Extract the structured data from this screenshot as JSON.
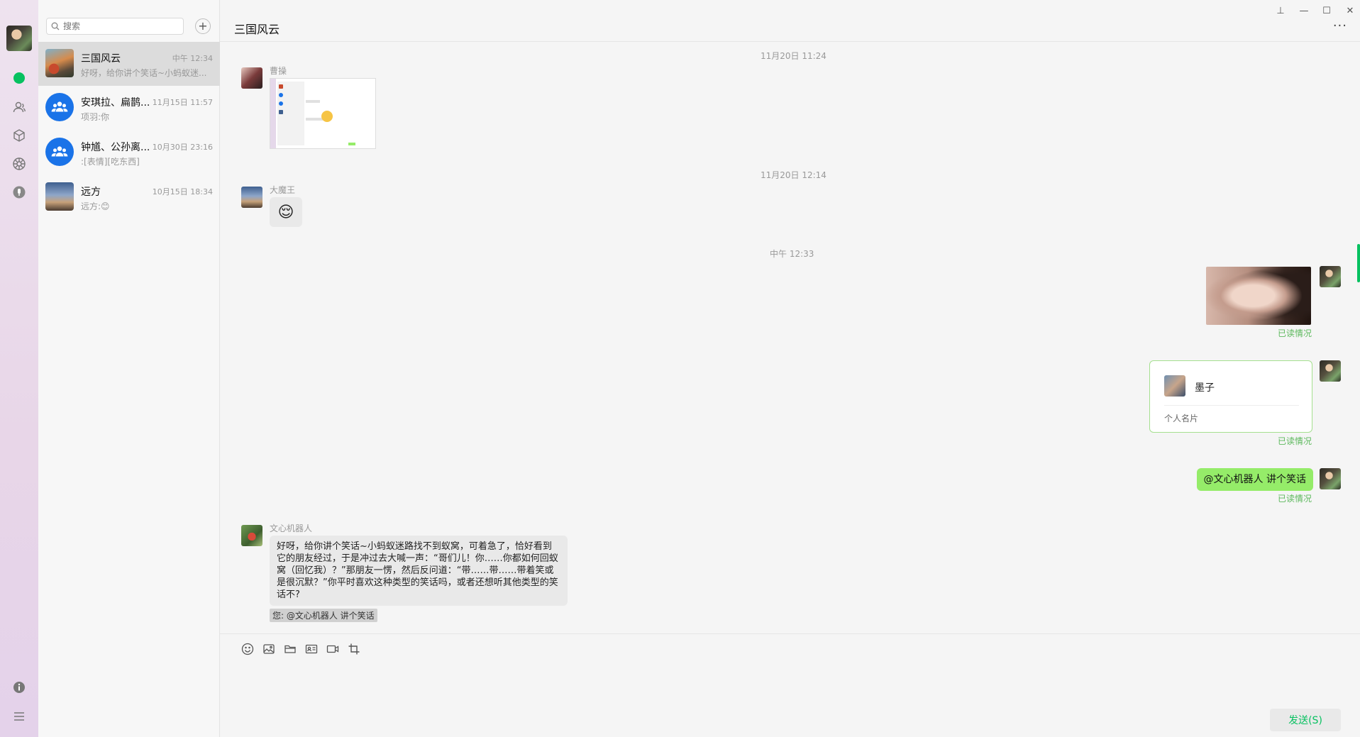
{
  "sidebar": {
    "icons": [
      "chat-icon",
      "contacts-icon",
      "box-icon",
      "moments-icon",
      "mic-icon",
      "info-icon",
      "menu-icon"
    ],
    "accent": "#07c160"
  },
  "list": {
    "search_placeholder": "搜索",
    "add_label": "+",
    "conversations": [
      {
        "name": "三国风云",
        "time": "中午 12:34",
        "preview": "好呀，给你讲个笑话~小蚂蚁迷..."
      },
      {
        "name": "安琪拉、扁鹊...",
        "time": "11月15日 11:57",
        "preview": "项羽:你"
      },
      {
        "name": "钟馗、公孙离...",
        "time": "10月30日 23:16",
        "preview": ":[表情][吃东西]"
      },
      {
        "name": "远方",
        "time": "10月15日 18:34",
        "preview": "远方:😊"
      }
    ]
  },
  "chat": {
    "title": "三国风云",
    "more": "···",
    "window": {
      "pin": "⊥",
      "minimize": "—",
      "maximize": "☐",
      "close": "✕"
    },
    "timestamps": [
      "11月20日 11:24",
      "11月20日 12:14",
      "中午 12:33"
    ],
    "msg1": {
      "sender": "曹操"
    },
    "msg2": {
      "sender": "大魔王",
      "emoji": "😌"
    },
    "read_label": "已读情况",
    "card": {
      "name": "墨子",
      "label": "个人名片"
    },
    "text_msg": "@文心机器人 讲个笑话",
    "reply": {
      "sender": "文心机器人",
      "text": "好呀，给你讲个笑话~小蚂蚁迷路找不到蚁窝，可着急了，恰好看到它的朋友经过，于是冲过去大喊一声：“哥们儿！你……你都如何回蚁窝（回忆我）？”那朋友一愣，然后反问道：“带……带……带着笑或是很沉默？”你平时喜欢这种类型的笑话吗，或者还想听其他类型的笑话不?",
      "quote": "您: @文心机器人 讲个笑话"
    },
    "tools": [
      "emoji-icon",
      "image-icon",
      "folder-icon",
      "card-icon",
      "video-icon",
      "crop-icon"
    ],
    "send_label": "发送(S)"
  }
}
